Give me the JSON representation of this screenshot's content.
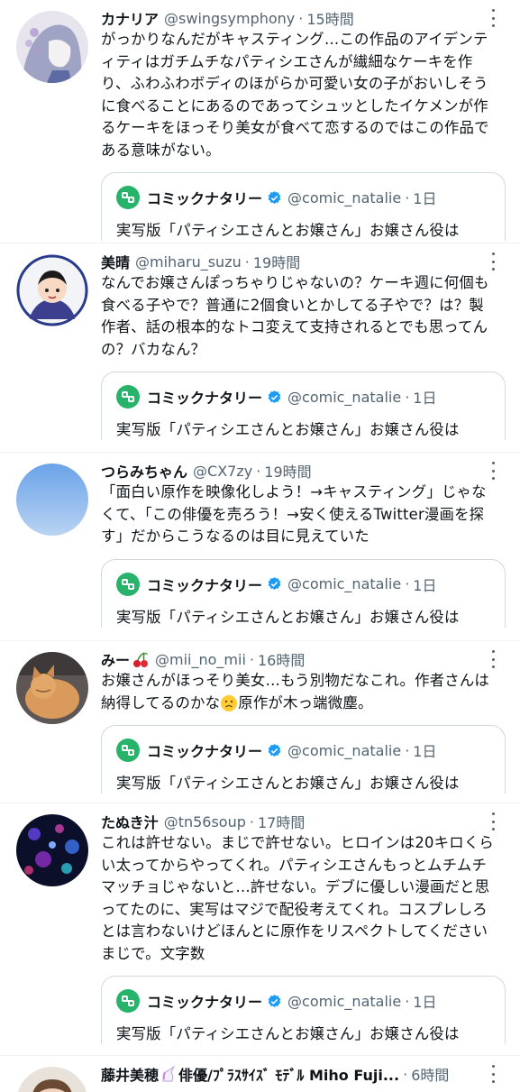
{
  "tweets": [
    {
      "name": "カナリア",
      "handle": "@swingsymphony",
      "time": "15時間",
      "text": "がっかりなんだがキャスティング…この作品のアイデンティティはガチムチなパティシエさんが繊細なケーキを作り、ふわふわボディのほがらか可愛い女の子がおいしそうに食べることにあるのであってシュッとしたイケメンが作るケーキをほっそり美女が食べて恋するのではこの作品である意味がない。",
      "quote": {
        "name": "コミックナタリー",
        "handle": "@comic_natalie",
        "time": "1日",
        "text": "実写版「パティシエさんとお嬢さん」お嬢さん役は"
      }
    },
    {
      "name": "美晴",
      "handle": "@miharu_suzu",
      "time": "19時間",
      "text": "なんでお嬢さんぽっちゃりじゃないの？ケーキ週に何個も食べる子やで？普通に2個食いとかしてる子やで？は？製作者、話の根本的なトコ変えて支持されるとでも思ってんの？バカなん？",
      "quote": {
        "name": "コミックナタリー",
        "handle": "@comic_natalie",
        "time": "1日",
        "text": "実写版「パティシエさんとお嬢さん」お嬢さん役は"
      }
    },
    {
      "name": "つらみちゃん",
      "handle": "@CX7zy",
      "time": "19時間",
      "text": "「面白い原作を映像化しよう！→キャスティング」じゃなくて、「この俳優を売ろう！→安く使えるTwitter漫画を探す」だからこうなるのは目に見えていた",
      "quote": {
        "name": "コミックナタリー",
        "handle": "@comic_natalie",
        "time": "1日",
        "text": "実写版「パティシエさんとお嬢さん」お嬢さん役は"
      }
    },
    {
      "name": "みー",
      "handle": "@mii_no_mii",
      "time": "16時間",
      "text_a": "お嬢さんがほっそり美女…もう別物だなこれ。作者さんは納得してるのかな",
      "text_b": "原作が木っ端微塵。",
      "quote": {
        "name": "コミックナタリー",
        "handle": "@comic_natalie",
        "time": "1日",
        "text": "実写版「パティシエさんとお嬢さん」お嬢さん役は"
      }
    },
    {
      "name": "たぬき汁",
      "handle": "@tn56soup",
      "time": "17時間",
      "text": "これは許せない。まじで許せない。ヒロインは20キロくらい太ってからやってくれ。パティシエさんもっとムチムチマッチョじゃないと…許せない。デブに優しい漫画だと思ってたのに、実写はマジで配役考えてくれ。コスプレしろとは言わないけどほんとに原作をリスペクトしてくださいまじで。文字数",
      "quote": {
        "name": "コミックナタリー",
        "handle": "@comic_natalie",
        "time": "1日",
        "text": "実写版「パティシエさんとお嬢さん」お嬢さん役は"
      }
    },
    {
      "name": "藤井美穂",
      "name_suffix": "俳優/ﾌﾟﾗｽｻｲｽﾞ ﾓﾃﾞﾙ Miho Fuji...",
      "handle": "",
      "time": "6時間"
    }
  ],
  "colors": {
    "accent_green": "#27b36a",
    "verified_blue": "#1d9bf0",
    "secondary_text": "#536471",
    "divider": "#eff3f4"
  },
  "icons": {
    "more": "more-dots-icon",
    "verified": "verified-badge-icon",
    "logo": "comic-natalie-logo-icon"
  }
}
